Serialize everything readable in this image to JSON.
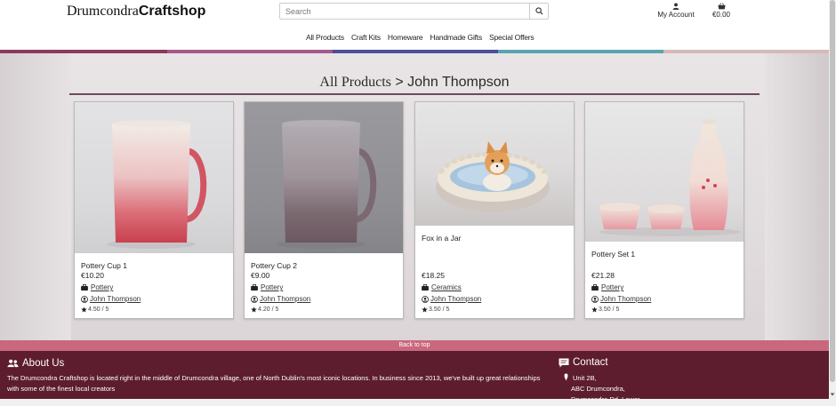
{
  "header": {
    "logo_part1": "Drumcondra",
    "logo_part2": "Craftshop",
    "search_placeholder": "Search",
    "account_label": "My Account",
    "cart_total": "€0.00"
  },
  "nav": {
    "items": [
      "All Products",
      "Craft Kits",
      "Homeware",
      "Handmade Gifts",
      "Special Offers"
    ]
  },
  "colors": {
    "stripe": [
      "#8b3a5c",
      "#a35a8a",
      "#4b4f9a",
      "#5aa3b0",
      "#d6b9b9"
    ],
    "footer": "#5d1d2f",
    "backtop": "#c9687d",
    "title_rule": "#6b4a5d"
  },
  "breadcrumb": {
    "root": "All Products",
    "separator": " > ",
    "current": "John Thompson"
  },
  "products": [
    {
      "name": "Pottery Cup 1",
      "price": "€10.20",
      "category": "Pottery",
      "maker": "John Thompson",
      "rating": "4.50 / 5"
    },
    {
      "name": "Pottery Cup 2",
      "price": "€9.00",
      "category": "Pottery",
      "maker": "John Thompson",
      "rating": "4.20 / 5"
    },
    {
      "name": "Fox in a Jar",
      "price": "€18.25",
      "category": "Ceramics",
      "maker": "John Thompson",
      "rating": "3.50 / 5"
    },
    {
      "name": "Pottery Set 1",
      "price": "€21.28",
      "category": "Pottery",
      "maker": "John Thompson",
      "rating": "3.50 / 5"
    }
  ],
  "backtop": "Back to top",
  "footer": {
    "about_title": "About Us",
    "about_text": "The Drumcondra Craftshop is located right in the middle of Drumcondra village, one of North Dublin's most iconic locations. In business since 2013, we've built up great relationships with some of the finest local creators",
    "contact_title": "Contact",
    "address": [
      "Unit 2B,",
      "ABC Drumcondra,",
      "Drumcondra Rd. Lower"
    ]
  }
}
